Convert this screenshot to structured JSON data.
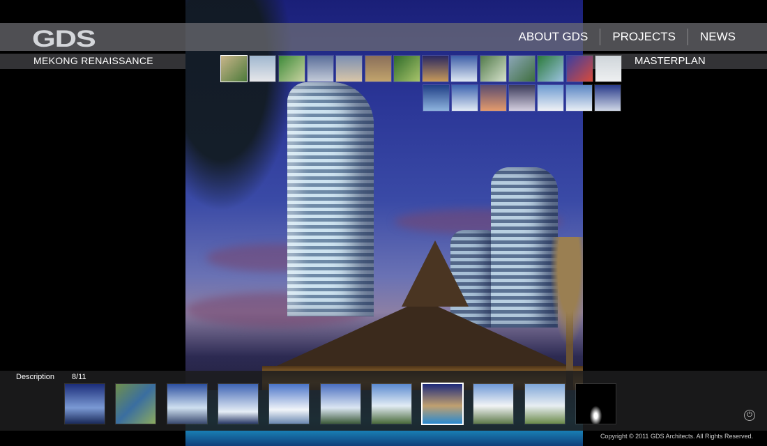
{
  "header": {
    "logo_text": "GDS",
    "nav": [
      "ABOUT GDS",
      "PROJECTS",
      "NEWS"
    ]
  },
  "project": {
    "title": "MEKONG RENAISSANCE",
    "category": "MASTERPLAN"
  },
  "project_thumbnails": {
    "row1_count": 14,
    "row2_count": 7,
    "selected_index": 0
  },
  "gallery": {
    "description_label": "Description",
    "counter": "8/11",
    "current_index": 8,
    "total": 11
  },
  "footer": {
    "copyright": "Copyright © 2011 GDS Architects. All Rights Reserved."
  },
  "icons": {
    "power": "power-icon"
  },
  "colors": {
    "background": "#000000",
    "bar": "#6e6e73",
    "text": "#ffffff"
  }
}
